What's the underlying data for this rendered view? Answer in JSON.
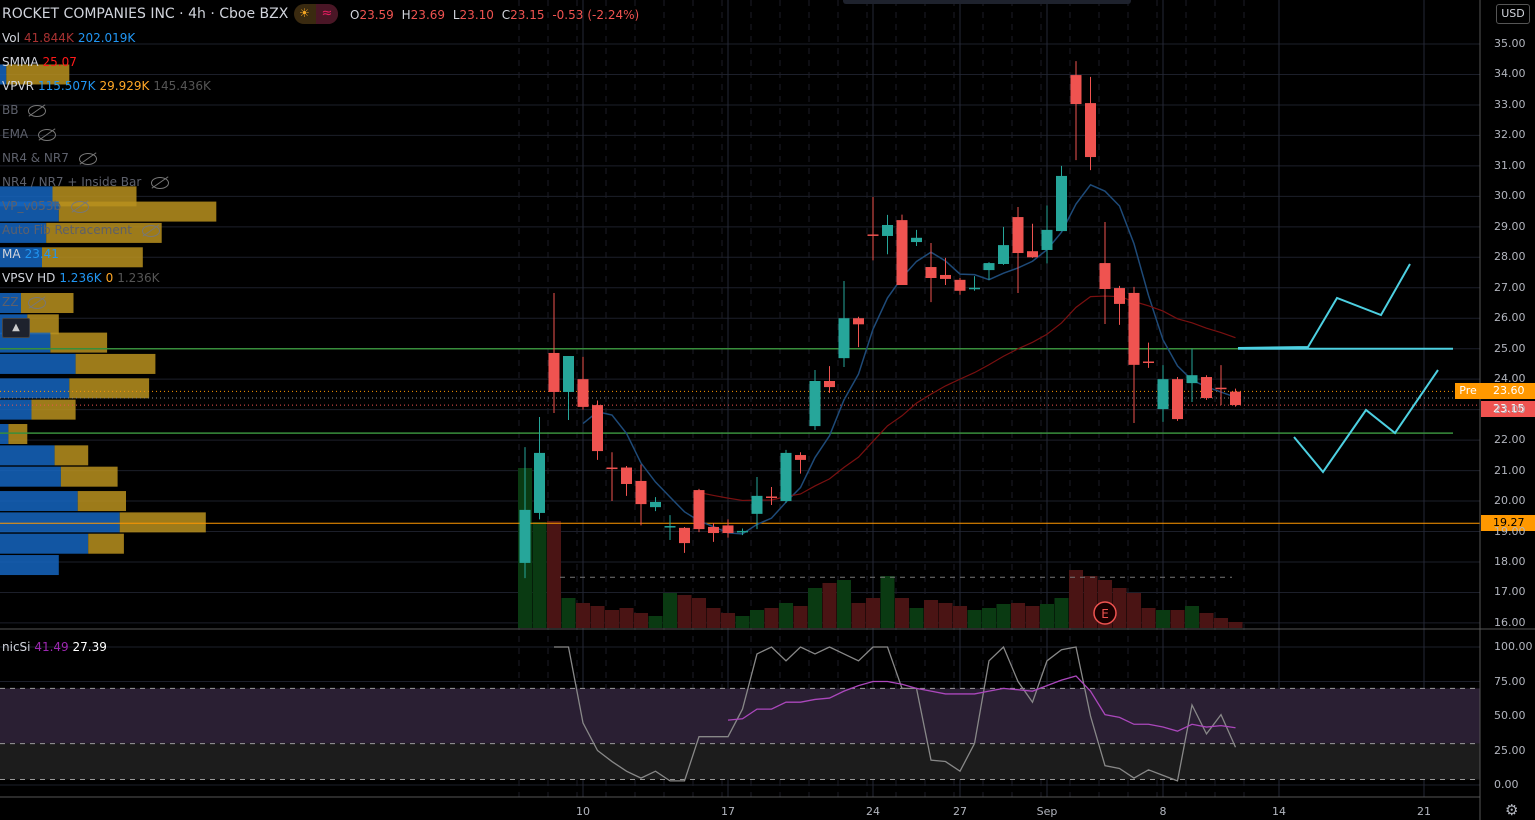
{
  "header": {
    "symbol": "ROCKET COMPANIES INC",
    "interval": "4h",
    "exchange": "Cboe BZX",
    "sep": "·",
    "open_label": "O",
    "open": "23.59",
    "high_label": "H",
    "high": "23.69",
    "low_label": "L",
    "low": "23.10",
    "close_label": "C",
    "close": "23.15",
    "change": "-0.53",
    "change_pct": "(-2.24%)",
    "session_icon": "sun-icon",
    "badge_icon": "approx-icon"
  },
  "indicators": [
    {
      "name": "Vol",
      "values": [
        "41.844K",
        "202.019K"
      ],
      "colors": [
        "#a83232",
        "#2196f3"
      ],
      "hidden": false
    },
    {
      "name": "SMMA",
      "values": [
        "25.07"
      ],
      "colors": [
        "#ff1a1a"
      ],
      "hidden": false
    },
    {
      "name": "VPVR",
      "values": [
        "115.507K",
        "29.929K",
        "145.436K"
      ],
      "colors": [
        "#2196f3",
        "#ffa726",
        "#555555"
      ],
      "hidden": false
    },
    {
      "name": "BB",
      "values": [],
      "colors": [],
      "hidden": true
    },
    {
      "name": "EMA",
      "values": [],
      "colors": [],
      "hidden": true
    },
    {
      "name": "NR4 & NR7",
      "values": [],
      "colors": [],
      "hidden": true
    },
    {
      "name": "NR4 / NR7 + Inside Bar",
      "values": [],
      "colors": [],
      "hidden": true
    },
    {
      "name": "VP_v053b",
      "values": [],
      "colors": [],
      "hidden": true
    },
    {
      "name": "Auto Fib Retracement",
      "values": [],
      "colors": [],
      "hidden": true
    },
    {
      "name": "MA",
      "values": [
        "23.41"
      ],
      "colors": [
        "#2196f3"
      ],
      "hidden": false
    },
    {
      "name": "VPSV HD",
      "values": [
        "1.236K",
        "0",
        "1.236K"
      ],
      "colors": [
        "#2196f3",
        "#ffa726",
        "#555555"
      ],
      "hidden": false
    },
    {
      "name": "ZZ",
      "values": [],
      "colors": [],
      "hidden": true
    }
  ],
  "collapse_icon": "chevron-up-icon",
  "currency": "USD",
  "price_tags": {
    "pre_label": "Pre",
    "pre_price": "23.60",
    "last_price": "23.15",
    "level_price": "19.27"
  },
  "rsi_legend": {
    "name": "nicSi",
    "value1": "41.49",
    "value2": "27.39"
  },
  "colors": {
    "up": "#26a69a",
    "down": "#ef5350",
    "bg": "#000000",
    "grid": "#1c1f2a",
    "support": "#388e3c",
    "projection": "#4dd0e1",
    "pre": "#ff9800",
    "rsi": "#ab47bc"
  },
  "chart_data": [
    {
      "type": "candlestick",
      "title": "ROCKET COMPANIES INC · 4h · Cboe BZX",
      "ylim": [
        16,
        35
      ],
      "yticks": [
        "35.00",
        "34.00",
        "33.00",
        "32.00",
        "31.00",
        "30.00",
        "29.00",
        "28.00",
        "27.00",
        "26.00",
        "25.00",
        "24.00",
        "23.00",
        "22.00",
        "21.00",
        "20.00",
        "19.00",
        "18.00",
        "17.00",
        "16.00"
      ],
      "xticks": [
        "10",
        "17",
        "24",
        "27",
        "Sep",
        "8",
        "14",
        "21"
      ],
      "horizontal_levels": [
        25.0,
        22.23,
        19.27
      ],
      "ohlc": [
        [
          17.97,
          21.77,
          17.47,
          19.71
        ],
        [
          19.61,
          22.76,
          19.4,
          21.58
        ],
        [
          24.86,
          26.83,
          22.89,
          23.58
        ],
        [
          23.58,
          24.76,
          22.66,
          24.76
        ],
        [
          24.0,
          24.73,
          23.0,
          23.09
        ],
        [
          23.15,
          23.3,
          21.35,
          21.64
        ],
        [
          21.1,
          21.6,
          20.0,
          21.05
        ],
        [
          21.1,
          21.15,
          20.17,
          20.56
        ],
        [
          20.66,
          21.2,
          19.2,
          19.9
        ],
        [
          19.8,
          20.13,
          19.67,
          19.97
        ],
        [
          19.15,
          19.54,
          18.72,
          19.18
        ],
        [
          19.12,
          19.15,
          18.3,
          18.62
        ],
        [
          20.36,
          20.4,
          18.98,
          19.08
        ],
        [
          19.15,
          19.28,
          18.66,
          18.95
        ],
        [
          19.2,
          19.4,
          18.8,
          18.95
        ],
        [
          18.99,
          19.1,
          18.88,
          19.02
        ],
        [
          19.58,
          20.79,
          19.08,
          20.17
        ],
        [
          20.15,
          20.46,
          19.87,
          20.1
        ],
        [
          20.0,
          21.68,
          19.94,
          21.58
        ],
        [
          21.51,
          21.6,
          20.9,
          21.35
        ],
        [
          22.46,
          24.3,
          22.33,
          23.94
        ],
        [
          23.94,
          24.43,
          23.55,
          23.74
        ],
        [
          24.69,
          27.22,
          24.4,
          26.0
        ],
        [
          26.0,
          26.05,
          25.05,
          25.8
        ],
        [
          28.75,
          29.98,
          27.9,
          28.73
        ],
        [
          28.7,
          29.39,
          28.1,
          29.06
        ],
        [
          29.22,
          29.4,
          27.09,
          27.09
        ],
        [
          28.5,
          28.9,
          28.37,
          28.64
        ],
        [
          27.68,
          28.47,
          26.53,
          27.32
        ],
        [
          27.42,
          27.98,
          27.09,
          27.29
        ],
        [
          27.26,
          27.32,
          26.77,
          26.9
        ],
        [
          26.97,
          27.38,
          26.9,
          27.0
        ],
        [
          27.58,
          27.84,
          27.26,
          27.81
        ],
        [
          27.78,
          29.0,
          27.75,
          28.4
        ],
        [
          29.32,
          29.65,
          26.83,
          28.14
        ],
        [
          28.2,
          29.1,
          27.98,
          28.0
        ],
        [
          28.24,
          29.7,
          27.8,
          28.9
        ],
        [
          28.86,
          31.0,
          28.86,
          30.67
        ],
        [
          33.98,
          34.44,
          31.19,
          33.03
        ],
        [
          33.06,
          33.92,
          30.86,
          31.29
        ],
        [
          27.81,
          29.16,
          25.81,
          26.96
        ],
        [
          26.99,
          27.06,
          25.78,
          26.47
        ],
        [
          26.83,
          27.03,
          22.56,
          24.47
        ],
        [
          24.58,
          25.2,
          24.37,
          24.55
        ],
        [
          23.02,
          24.46,
          22.6,
          24.0
        ],
        [
          24.0,
          24.07,
          22.63,
          22.69
        ],
        [
          23.87,
          25.0,
          23.25,
          24.13
        ],
        [
          24.07,
          24.13,
          23.32,
          23.38
        ],
        [
          23.72,
          24.46,
          23.15,
          23.69
        ],
        [
          23.59,
          23.69,
          23.1,
          23.15
        ]
      ],
      "volume_k": [
        1120,
        742,
        749,
        210,
        175,
        154,
        126,
        140,
        105,
        84,
        245,
        231,
        210,
        140,
        105,
        84,
        126,
        140,
        175,
        154,
        280,
        315,
        336,
        175,
        210,
        364,
        210,
        140,
        196,
        175,
        154,
        126,
        140,
        168,
        175,
        154,
        168,
        210,
        406,
        364,
        336,
        280,
        245,
        140,
        126,
        126,
        154,
        105,
        70,
        42
      ],
      "volume_profile_k": [
        [
          34,
          3,
          30
        ],
        [
          30,
          25,
          40
        ],
        [
          29.5,
          28,
          75
        ],
        [
          28.8,
          22,
          55
        ],
        [
          28,
          20,
          48
        ],
        [
          26.5,
          10,
          25
        ],
        [
          25.8,
          13,
          15
        ],
        [
          25.2,
          24,
          27
        ],
        [
          24.5,
          36,
          38
        ],
        [
          23.7,
          33,
          38
        ],
        [
          23,
          15,
          21
        ],
        [
          22.2,
          4,
          9
        ],
        [
          21.5,
          26,
          16
        ],
        [
          20.8,
          29,
          27
        ],
        [
          20,
          37,
          23
        ],
        [
          19.3,
          57,
          41
        ],
        [
          18.6,
          42,
          17
        ],
        [
          17.9,
          28,
          0
        ]
      ],
      "earnings_marker": "E"
    },
    {
      "type": "line",
      "title": "nicSi",
      "ylim": [
        0,
        100
      ],
      "yticks": [
        "100.00",
        "75.00",
        "50.00",
        "25.00",
        "0.00"
      ],
      "bands": [
        30,
        70
      ],
      "series": [
        {
          "name": "nicSi",
          "start_index": 2,
          "values": [
            100,
            100,
            45,
            25,
            17,
            10,
            5,
            10,
            3,
            3,
            35,
            35,
            35,
            55,
            95,
            100,
            90,
            100,
            95,
            100,
            95,
            90,
            100,
            100,
            70,
            70,
            18,
            17,
            10,
            30,
            90,
            100,
            75,
            60,
            90,
            98,
            100,
            50,
            14,
            12,
            5,
            11,
            7,
            3,
            58,
            37,
            51,
            27.39
          ]
        },
        {
          "name": "signal",
          "start_index": 14,
          "values": [
            47,
            48,
            55,
            55,
            60,
            60,
            62,
            63,
            68,
            72,
            75,
            75,
            73,
            70,
            68,
            66,
            66,
            66,
            68,
            70,
            69,
            68,
            72,
            76,
            79,
            68,
            51,
            49,
            44,
            44,
            42,
            39,
            44,
            42,
            43,
            41.49
          ]
        }
      ]
    }
  ]
}
